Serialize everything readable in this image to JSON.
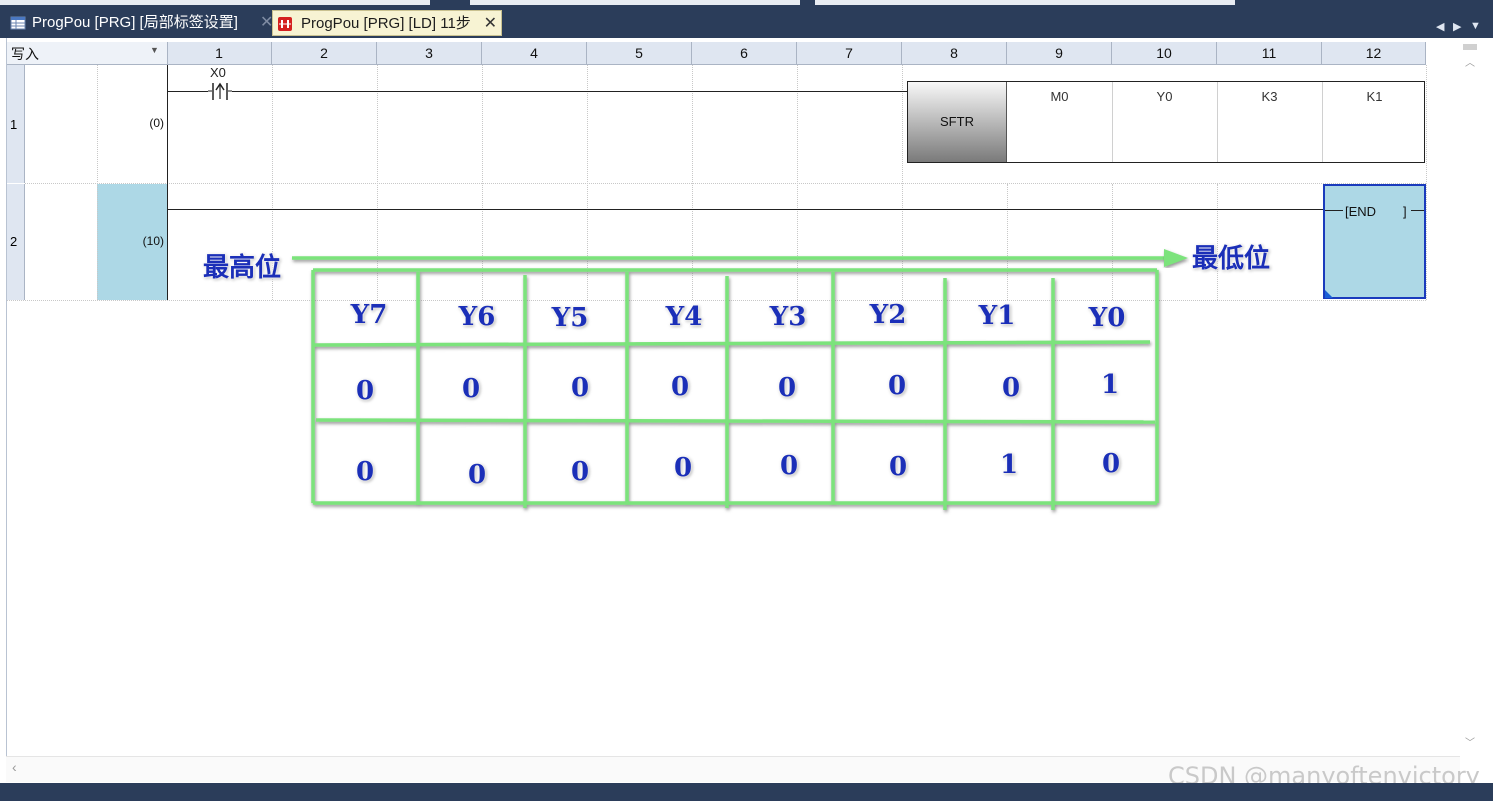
{
  "tabs": [
    {
      "label": "ProgPou [PRG] [局部标签设置]",
      "active": false,
      "icon": "table-icon"
    },
    {
      "label": "ProgPou [PRG] [LD] 11步",
      "active": true,
      "icon": "ladder-icon"
    }
  ],
  "tab_close_glyph": "✕",
  "tab_nav": {
    "prev": "◀",
    "next": "▶",
    "menu": "▼"
  },
  "editor": {
    "mode_label": "写入",
    "columns": [
      "1",
      "2",
      "3",
      "4",
      "5",
      "6",
      "7",
      "8",
      "9",
      "10",
      "11",
      "12"
    ],
    "rows": [
      {
        "number": "1",
        "step": "(0)"
      },
      {
        "number": "2",
        "step": "(10)"
      }
    ],
    "contact": {
      "device": "X0",
      "type": "rising-edge-contact"
    },
    "instruction": {
      "name": "SFTR",
      "operands": [
        "M0",
        "Y0",
        "K3",
        "K1"
      ]
    },
    "end_instruction": {
      "label": "[END",
      "right_bracket": "]"
    }
  },
  "overlay": {
    "msb_label": "最高位",
    "lsb_label": "最低位",
    "table": {
      "headers": [
        "Y7",
        "Y6",
        "Y5",
        "Y4",
        "Y3",
        "Y2",
        "Y1",
        "Y0"
      ],
      "rows": [
        [
          "0",
          "0",
          "0",
          "0",
          "0",
          "0",
          "0",
          "1"
        ],
        [
          "0",
          "0",
          "0",
          "0",
          "0",
          "0",
          "1",
          "0"
        ]
      ]
    },
    "line_color": "#7be37b",
    "text_color": "#1b2fb8"
  },
  "watermark": "CSDN @manyoftenvictory",
  "colors": {
    "selection": "#add8e6",
    "end_border": "#1a3bbd",
    "tab_active": "#f7f3d3",
    "chrome": "#2b3d5a"
  }
}
